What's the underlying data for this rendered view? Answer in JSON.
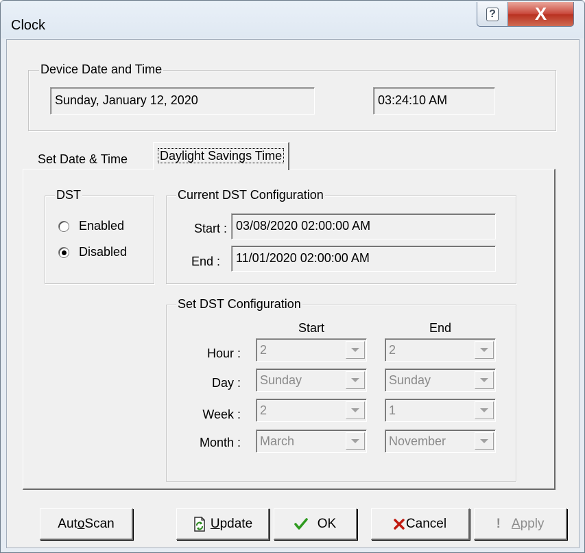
{
  "window": {
    "title": "Clock",
    "help_glyph": "?",
    "close_glyph": "X"
  },
  "device_group": {
    "label": "Device Date and Time",
    "date_value": "Sunday, January 12, 2020",
    "time_value": "03:24:10 AM"
  },
  "tabs": [
    {
      "label": "Set Date & Time",
      "active": false
    },
    {
      "label": "Daylight Savings Time",
      "active": true
    }
  ],
  "dst_group": {
    "label": "DST",
    "options": [
      {
        "label": "Enabled",
        "checked": false
      },
      {
        "label": "Disabled",
        "checked": true
      }
    ]
  },
  "current_dst": {
    "label": "Current DST Configuration",
    "start_label": "Start :",
    "start_value": "03/08/2020 02:00:00 AM",
    "end_label": "End :",
    "end_value": "11/01/2020 02:00:00 AM"
  },
  "set_dst": {
    "label": "Set DST Configuration",
    "col_start": "Start",
    "col_end": "End",
    "rows": [
      {
        "label": "Hour :",
        "start": "2",
        "end": "2"
      },
      {
        "label": "Day :",
        "start": "Sunday",
        "end": "Sunday"
      },
      {
        "label": "Week :",
        "start": "2",
        "end": "1"
      },
      {
        "label": "Month :",
        "start": "March",
        "end": "November"
      }
    ]
  },
  "buttons": {
    "autoscan": {
      "pre": "Aut",
      "mnemonic": "o",
      "post": " Scan"
    },
    "update": {
      "pre": "",
      "mnemonic": "U",
      "post": "pdate"
    },
    "ok": {
      "label": "OK"
    },
    "cancel": {
      "label": "Cancel"
    },
    "apply": {
      "pre": "",
      "mnemonic": "A",
      "post": "pply",
      "icon": "!"
    }
  },
  "colors": {
    "ok_check": "#2e9a1f",
    "cancel_x": "#c01a10",
    "close_button": "#c9473a"
  },
  "icons": {
    "ok": "check-icon",
    "cancel": "x-icon",
    "update": "update-icon",
    "apply": "exclamation-icon"
  }
}
